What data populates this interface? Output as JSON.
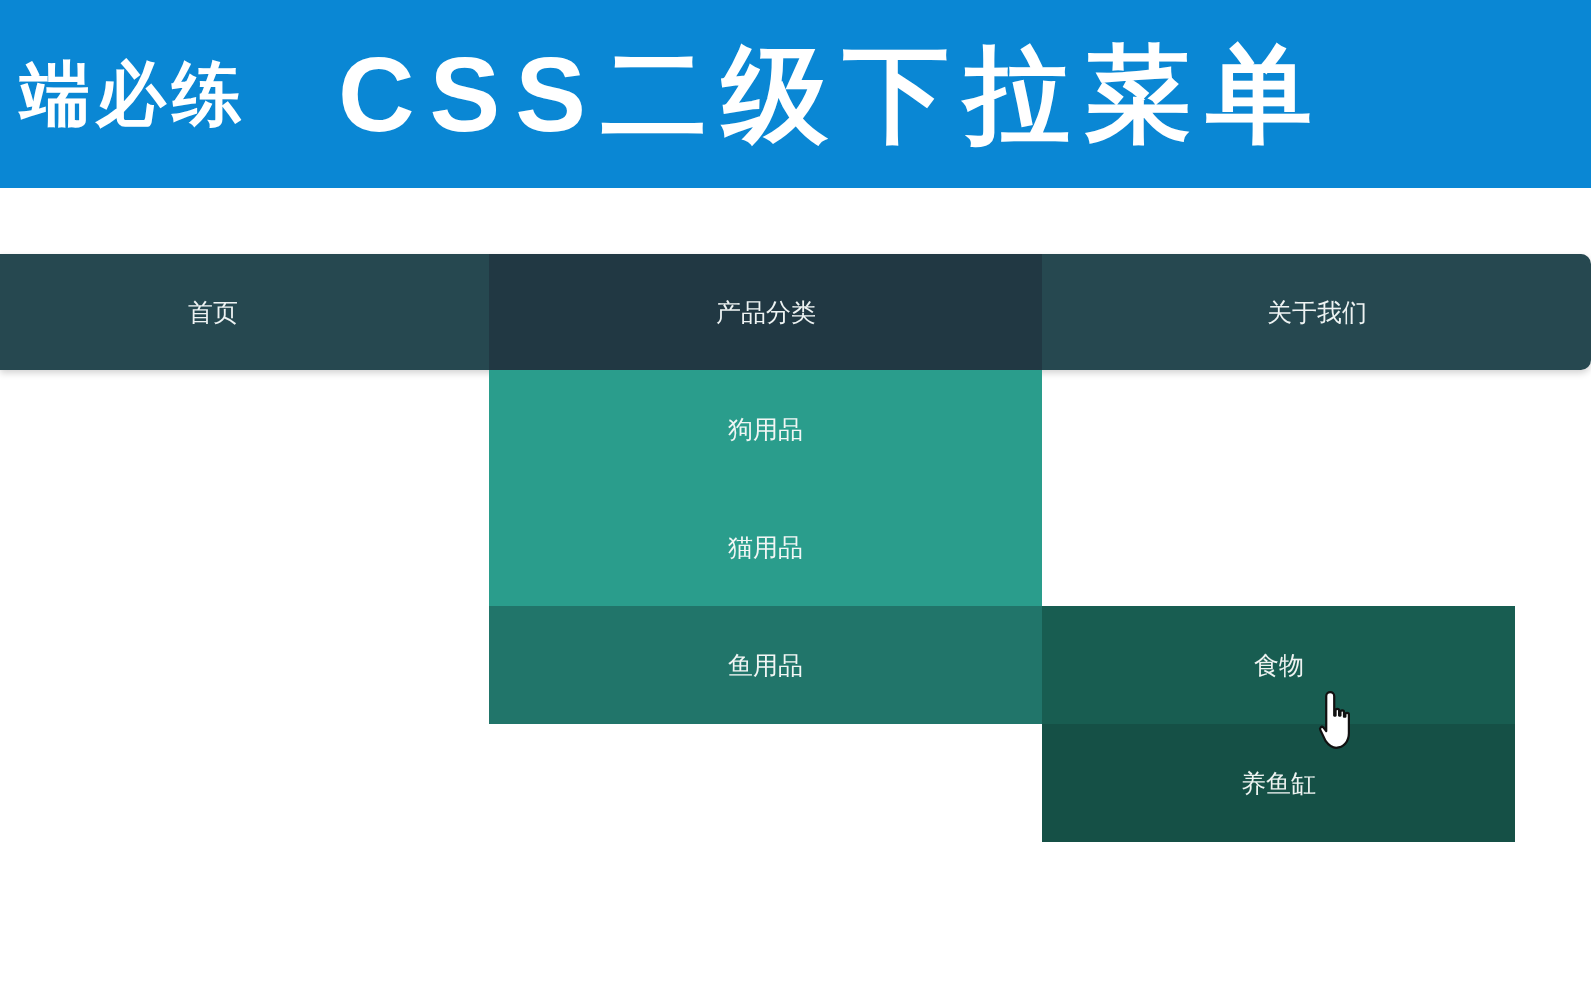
{
  "banner": {
    "subtitle": "端必练",
    "title": "CSS二级下拉菜单"
  },
  "nav": {
    "items": [
      {
        "label": "首页",
        "selected": false
      },
      {
        "label": "产品分类",
        "selected": true,
        "children": [
          {
            "label": "狗用品",
            "selected": false
          },
          {
            "label": "猫用品",
            "selected": false
          },
          {
            "label": "鱼用品",
            "selected": true,
            "children": [
              {
                "label": "食物",
                "selected": true
              },
              {
                "label": "养鱼缸",
                "selected": false
              }
            ]
          }
        ]
      },
      {
        "label": "关于我们",
        "selected": false
      }
    ]
  }
}
